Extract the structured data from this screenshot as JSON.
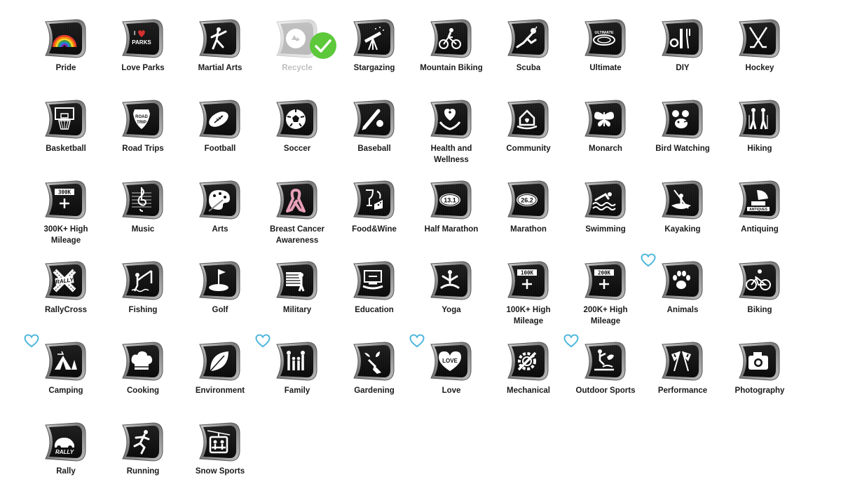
{
  "tiles": [
    {
      "label": "Pride",
      "icon": "rainbow-icon"
    },
    {
      "label": "Love Parks",
      "icon": "parks-icon"
    },
    {
      "label": "Martial Arts",
      "icon": "martial-arts-icon"
    },
    {
      "label": "Recycle",
      "icon": "recycle-icon",
      "state": "selected"
    },
    {
      "label": "Stargazing",
      "icon": "telescope-icon"
    },
    {
      "label": "Mountain Biking",
      "icon": "mountain-bike-icon"
    },
    {
      "label": "Scuba",
      "icon": "scuba-diver-icon"
    },
    {
      "label": "Ultimate",
      "icon": "frisbee-icon"
    },
    {
      "label": "DIY",
      "icon": "tools-icon"
    },
    {
      "label": "Hockey",
      "icon": "hockey-sticks-icon"
    },
    {
      "label": "Basketball",
      "icon": "basketball-hoop-icon"
    },
    {
      "label": "Road Trips",
      "icon": "road-trip-sign-icon"
    },
    {
      "label": "Football",
      "icon": "football-icon"
    },
    {
      "label": "Soccer",
      "icon": "soccer-ball-icon"
    },
    {
      "label": "Baseball",
      "icon": "baseball-bat-icon"
    },
    {
      "label": "Health and Wellness",
      "icon": "health-hands-icon"
    },
    {
      "label": "Community",
      "icon": "community-house-icon"
    },
    {
      "label": "Monarch",
      "icon": "butterfly-icon"
    },
    {
      "label": "Bird Watching",
      "icon": "binoculars-bird-icon"
    },
    {
      "label": "Hiking",
      "icon": "hikers-icon"
    },
    {
      "label": "300K+ High Mileage",
      "icon": "mileage-300k-icon"
    },
    {
      "label": "Music",
      "icon": "treble-clef-icon"
    },
    {
      "label": "Arts",
      "icon": "paint-palette-icon"
    },
    {
      "label": "Breast Cancer Awareness",
      "icon": "pink-ribbon-icon"
    },
    {
      "label": "Food&Wine",
      "icon": "food-wine-icon"
    },
    {
      "label": "Half Marathon",
      "icon": "half-marathon-13-1-icon"
    },
    {
      "label": "Marathon",
      "icon": "marathon-26-2-icon"
    },
    {
      "label": "Swimming",
      "icon": "swimmer-icon"
    },
    {
      "label": "Kayaking",
      "icon": "kayak-icon"
    },
    {
      "label": "Antiquing",
      "icon": "antiques-gramophone-icon"
    },
    {
      "label": "RallyCross",
      "icon": "rallycross-icon"
    },
    {
      "label": "Fishing",
      "icon": "fishing-icon"
    },
    {
      "label": "Golf",
      "icon": "golf-flag-icon"
    },
    {
      "label": "Military",
      "icon": "military-flag-icon"
    },
    {
      "label": "Education",
      "icon": "education-book-icon"
    },
    {
      "label": "Yoga",
      "icon": "yoga-pose-icon"
    },
    {
      "label": "100K+ High Mileage",
      "icon": "mileage-100k-icon"
    },
    {
      "label": "200K+ High Mileage",
      "icon": "mileage-200k-icon"
    },
    {
      "label": "Animals",
      "icon": "paw-print-icon",
      "favorite": true
    },
    {
      "label": "Biking",
      "icon": "bicycle-icon"
    },
    {
      "label": "Camping",
      "icon": "camping-icon",
      "favorite": true
    },
    {
      "label": "Cooking",
      "icon": "chef-hat-icon"
    },
    {
      "label": "Environment",
      "icon": "leaf-icon"
    },
    {
      "label": "Family",
      "icon": "family-icon",
      "favorite": true
    },
    {
      "label": "Gardening",
      "icon": "gardening-icon"
    },
    {
      "label": "Love",
      "icon": "love-heart-icon",
      "favorite": true
    },
    {
      "label": "Mechanical",
      "icon": "wrench-gear-icon"
    },
    {
      "label": "Outdoor Sports",
      "icon": "outdoor-sports-icon",
      "favorite": true
    },
    {
      "label": "Performance",
      "icon": "checkered-flags-icon"
    },
    {
      "label": "Photography",
      "icon": "camera-icon"
    },
    {
      "label": "Rally",
      "icon": "rally-car-icon"
    },
    {
      "label": "Running",
      "icon": "runner-icon"
    },
    {
      "label": "Snow Sports",
      "icon": "ski-lift-icon"
    }
  ],
  "glyph_text": {
    "parks": [
      "I",
      "PARKS"
    ],
    "road_trip": [
      "ROAD",
      "TRIP"
    ],
    "mileage_300k": "300K",
    "mileage_100k": "100K",
    "mileage_200k": "200K",
    "half_marathon": "13.1",
    "marathon": "26.2",
    "antiques": "ANTIQUES",
    "rally": "RALLY",
    "love": "LOVE",
    "ultimate": "ULTIMATE"
  },
  "colors": {
    "favorite_heart": "#4fb7dd",
    "selected_check": "#5cc83a",
    "badge_face": "#111111",
    "badge_rim": "#8a8a8a",
    "ribbon": "#e7a0b8",
    "label_text": "#1a1a1a"
  }
}
